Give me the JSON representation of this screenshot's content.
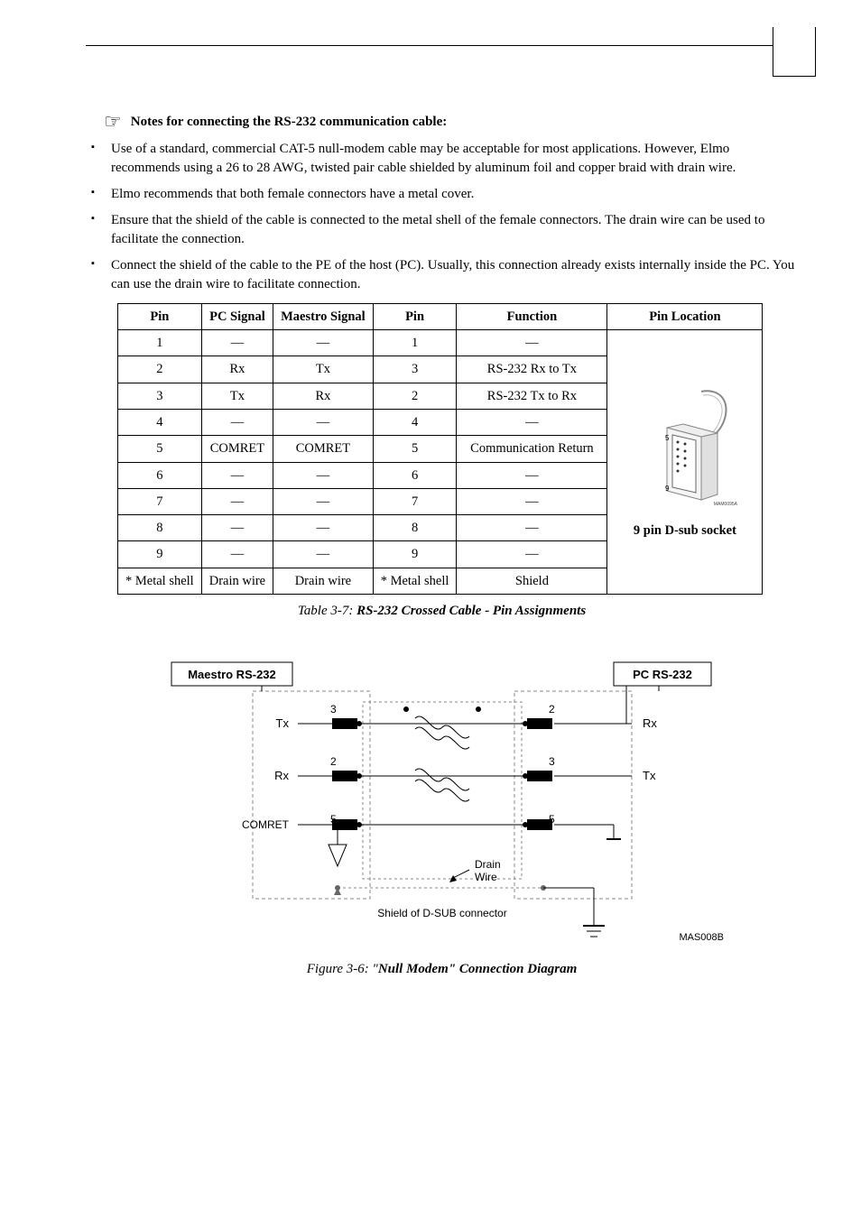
{
  "notes_title": "Notes for connecting the RS-232 communication cable:",
  "bullets": [
    "Use of a standard, commercial CAT-5 null-modem cable may be acceptable for most applications. However, Elmo recommends using a 26 to 28 AWG, twisted pair cable shielded by aluminum foil and copper braid with drain wire.",
    "Elmo recommends that both female connectors have a metal cover.",
    "Ensure that the shield of the cable is connected to the metal shell of the female connectors. The drain wire can be used to facilitate the connection.",
    "Connect the shield of the cable to the PE of the host (PC). Usually, this connection already exists internally inside the PC. You can use the drain wire to facilitate connection."
  ],
  "table": {
    "headers": [
      "Pin",
      "PC Signal",
      "Maestro Signal",
      "Pin",
      "Function",
      "Pin Location"
    ],
    "rows": [
      {
        "pin_a": "1",
        "pc": "—",
        "maestro": "—",
        "pin_b": "1",
        "func": "—"
      },
      {
        "pin_a": "2",
        "pc": "Rx",
        "maestro": "Tx",
        "pin_b": "3",
        "func": "RS-232 Rx to Tx"
      },
      {
        "pin_a": "3",
        "pc": "Tx",
        "maestro": "Rx",
        "pin_b": "2",
        "func": "RS-232 Tx to Rx"
      },
      {
        "pin_a": "4",
        "pc": "—",
        "maestro": "—",
        "pin_b": "4",
        "func": "—"
      },
      {
        "pin_a": "5",
        "pc": "COMRET",
        "maestro": "COMRET",
        "pin_b": "5",
        "func": "Communication Return"
      },
      {
        "pin_a": "6",
        "pc": "—",
        "maestro": "—",
        "pin_b": "6",
        "func": "—"
      },
      {
        "pin_a": "7",
        "pc": "—",
        "maestro": "—",
        "pin_b": "7",
        "func": "—"
      },
      {
        "pin_a": "8",
        "pc": "—",
        "maestro": "—",
        "pin_b": "8",
        "func": "—"
      },
      {
        "pin_a": "9",
        "pc": "—",
        "maestro": "—",
        "pin_b": "9",
        "func": "—"
      },
      {
        "pin_a": "* Metal shell",
        "pc": "Drain wire",
        "maestro": "Drain wire",
        "pin_b": "* Metal shell",
        "func": "Shield"
      }
    ],
    "loc_caption": "9 pin D-sub socket",
    "loc_small": "MAM0095A"
  },
  "table_caption_prefix": "Table 3-7: ",
  "table_caption_bold": "RS-232 Crossed Cable - Pin Assignments",
  "diagram": {
    "left_box": "Maestro RS-232",
    "right_box": "PC RS-232",
    "tx": "Tx",
    "rx": "Rx",
    "comret": "COMRET",
    "n2": "2",
    "n3": "3",
    "n5": "5",
    "drain": "Drain",
    "wire": "Wire",
    "shield_label": "Shield of D-SUB connector",
    "code": "MAS008B"
  },
  "figure_caption_prefix": "Figure 3-6: \"",
  "figure_caption_bold": "Null Modem\" Connection Diagram"
}
